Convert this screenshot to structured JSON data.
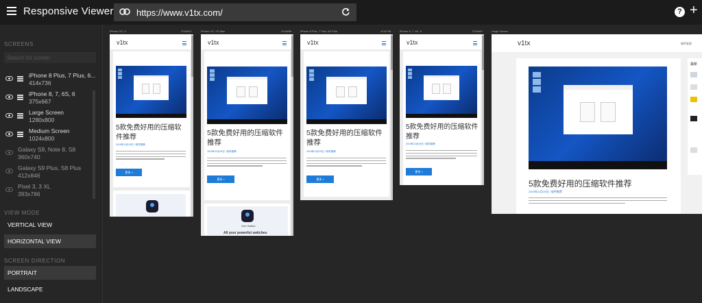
{
  "app": {
    "title": "Responsive Viewer",
    "url": "https://www.v1tx.com/"
  },
  "sidebar": {
    "screens_label": "SCREENS",
    "search_placeholder": "Search for screen",
    "screens": [
      {
        "name": "iPhone 8 Plus, 7 Plus, 6...",
        "dims": "414x736",
        "visible": true
      },
      {
        "name": "iPhone 8, 7, 6S, 6",
        "dims": "375x667",
        "visible": true
      },
      {
        "name": "Large Screen",
        "dims": "1280x800",
        "visible": true
      },
      {
        "name": "Medium Screen",
        "dims": "1024x800",
        "visible": true
      },
      {
        "name": "Galaxy S9, Note 8, S8",
        "dims": "360x740",
        "visible": false
      },
      {
        "name": "Galaxy S9 Plus, S8 Plus",
        "dims": "412x846",
        "visible": false
      },
      {
        "name": "Pixel 3, 3 XL",
        "dims": "393x786",
        "visible": false
      }
    ],
    "view_mode_label": "VIEW MODE",
    "view_modes": [
      "VERTICAL VIEW",
      "HORIZONTAL VIEW"
    ],
    "active_view_mode": "HORIZONTAL VIEW",
    "direction_label": "SCREEN DIRECTION",
    "directions": [
      "PORTRAIT",
      "LANDSCAPE"
    ],
    "active_direction": "PORTRAIT"
  },
  "devices": [
    {
      "label": "iPhone XS, X",
      "res": "375x812"
    },
    {
      "label": "iPhone XS, XS Max",
      "res": "414x896"
    },
    {
      "label": "iPhone 8 Plus, 7 Plus, 6S Plus",
      "res": "414x736"
    },
    {
      "label": "iPhone 8, 7, 6S, 6",
      "res": "375x667"
    },
    {
      "label": "Large Screen",
      "res": ""
    }
  ],
  "site": {
    "logo": "v1tx",
    "article_title": "5款免费好用的压缩软件推荐",
    "article_meta": "2019年11月19日 / 软件推荐",
    "more_label": "更多 »",
    "promo_caption": "One Switch",
    "promo_headline": "All your powerful switches",
    "large_nav": "软件发现",
    "sidebar_widget_title": "最新"
  },
  "colors": {
    "accent": "#1e7bd8",
    "topbar": "#1b1b1b",
    "sidebar": "#262626"
  }
}
